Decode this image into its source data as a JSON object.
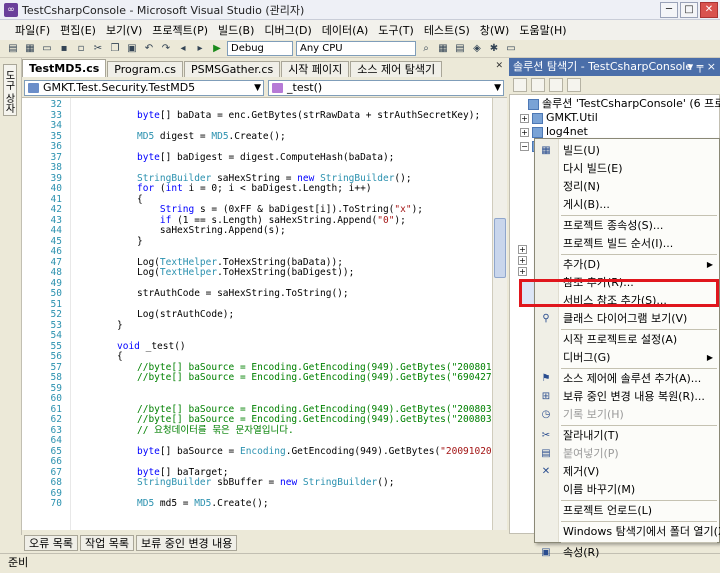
{
  "window": {
    "title": "TestCsharpConsole - Microsoft Visual Studio (관리자)",
    "minimize": "─",
    "maximize": "□",
    "close": "✕"
  },
  "menu": [
    "파일(F)",
    "편집(E)",
    "보기(V)",
    "프로젝트(P)",
    "빌드(B)",
    "디버그(D)",
    "데이터(A)",
    "도구(T)",
    "테스트(S)",
    "창(W)",
    "도움말(H)"
  ],
  "toolbar": {
    "config": "Debug",
    "platform": "Any CPU"
  },
  "toolbox_tab": "도구 상자",
  "doc_tabs": [
    "TestMD5.cs",
    "Program.cs",
    "PSMSGather.cs",
    "시작 페이지",
    "소스 제어 탐색기"
  ],
  "nav": {
    "type": "GMKT.Test.Security.TestMD5",
    "member": "_test()"
  },
  "code_lines": [
    {
      "n": "32",
      "t": ""
    },
    {
      "n": "33",
      "t": "<span class='kw'>byte</span>[] baData = enc.GetBytes(strRawData + strAuthSecretKey);"
    },
    {
      "n": "34",
      "t": ""
    },
    {
      "n": "35",
      "t": "<span class='cls'>MD5</span> digest = <span class='cls'>MD5</span>.Create();"
    },
    {
      "n": "36",
      "t": ""
    },
    {
      "n": "37",
      "t": "<span class='kw'>byte</span>[] baDigest = digest.ComputeHash(baData);"
    },
    {
      "n": "38",
      "t": ""
    },
    {
      "n": "39",
      "t": "<span class='cls'>StringBuilder</span> saHexString = <span class='kw'>new</span> <span class='cls'>StringBuilder</span>();"
    },
    {
      "n": "40",
      "t": "<span class='kw'>for</span> (<span class='kw'>int</span> i = 0; i &lt; baDigest.Length; i++)"
    },
    {
      "n": "41",
      "t": "{"
    },
    {
      "n": "42",
      "t": "    <span class='kw'>String</span> s = (0xFF &amp; baDigest[i]).ToString(<span class='str'>\"x\"</span>);"
    },
    {
      "n": "43",
      "t": "    <span class='kw'>if</span> (1 == s.Length) saHexString.Append(<span class='str'>\"0\"</span>);"
    },
    {
      "n": "44",
      "t": "    saHexString.Append(s);"
    },
    {
      "n": "45",
      "t": "}"
    },
    {
      "n": "46",
      "t": ""
    },
    {
      "n": "47",
      "t": "Log(<span class='cls'>TextHelper</span>.ToHexString(baData));"
    },
    {
      "n": "48",
      "t": "Log(<span class='cls'>TextHelper</span>.ToHexString(baDigest));"
    },
    {
      "n": "49",
      "t": ""
    },
    {
      "n": "50",
      "t": "strAuthCode = saHexString.ToString();"
    },
    {
      "n": "51",
      "t": ""
    },
    {
      "n": "52",
      "t": "Log(strAuthCode);"
    },
    {
      "n": "53",
      "t": "}",
      "indent": -1
    },
    {
      "n": "54",
      "t": ""
    },
    {
      "n": "55",
      "t": "<span class='kw'>void</span> _test()",
      "indent": -1
    },
    {
      "n": "56",
      "t": "{",
      "indent": -1
    },
    {
      "n": "57",
      "t": "<span class='cm'>//byte[] baSource = Encoding.GetEncoding(949).GetBytes(\"20080125133</span>"
    },
    {
      "n": "58",
      "t": "<span class='cm'>//byte[] baSource = Encoding.GetEncoding(949).GetBytes(\"6904271jeep</span>"
    },
    {
      "n": "59",
      "t": ""
    },
    {
      "n": "60",
      "t": ""
    },
    {
      "n": "61",
      "t": "<span class='cm'>//byte[] baSource = Encoding.GetEncoding(949).GetBytes(\"20080327115</span>"
    },
    {
      "n": "62",
      "t": "<span class='cm'>//byte[] baSource = Encoding.GetEncoding(949).GetBytes(\"20080327115</span>"
    },
    {
      "n": "63",
      "t": "<span class='cm'>// 요청데이터를 묶은 문자열입니다.</span>"
    },
    {
      "n": "64",
      "t": ""
    },
    {
      "n": "65",
      "t": "<span class='kw'>byte</span>[] baSource = <span class='cls'>Encoding</span>.GetEncoding(949).GetBytes(<span class='str'>\"200910201428</span>"
    },
    {
      "n": "66",
      "t": ""
    },
    {
      "n": "67",
      "t": "<span class='kw'>byte</span>[] baTarget;"
    },
    {
      "n": "68",
      "t": "<span class='cls'>StringBuilder</span> sbBuffer = <span class='kw'>new</span> <span class='cls'>StringBuilder</span>();"
    },
    {
      "n": "69",
      "t": ""
    },
    {
      "n": "70",
      "t": "<span class='cls'>MD5</span> md5 = <span class='cls'>MD5</span>.Create();"
    }
  ],
  "bottom_tabs": [
    "오류 목록",
    "작업 목록",
    "보류 중인 변경 내용"
  ],
  "status": "준비",
  "solution_explorer": {
    "title": "솔루션 탐색기 - TestCsharpConsole",
    "pin": "▾ ╤ ×",
    "tree": [
      {
        "label": "솔루션 'TestCsharpConsole' (6 프로젝트)",
        "level": 0,
        "pm": ""
      },
      {
        "label": "GMKT.Util",
        "level": 1,
        "pm": "+"
      },
      {
        "label": "log4net",
        "level": 1,
        "pm": "+"
      },
      {
        "label": "TestCsharpConsole",
        "level": 1,
        "pm": "−",
        "selected": true
      }
    ]
  },
  "context_menu": [
    {
      "label": "빌드(U)",
      "icon": "▦",
      "sep_after": false
    },
    {
      "label": "다시 빌드(E)",
      "icon": "",
      "sep_after": false
    },
    {
      "label": "정리(N)",
      "icon": "",
      "sep_after": false
    },
    {
      "label": "게시(B)...",
      "icon": "",
      "sep_after": true
    },
    {
      "label": "프로젝트 종속성(S)...",
      "icon": "",
      "sep_after": false
    },
    {
      "label": "프로젝트 빌드 순서(I)...",
      "icon": "",
      "sep_after": true
    },
    {
      "label": "추가(D)",
      "icon": "",
      "arrow": true,
      "sep_after": false
    },
    {
      "label": "참조 추가(R)...",
      "icon": "",
      "sep_after": false
    },
    {
      "label": "서비스 참조 추가(S)...",
      "icon": "",
      "highlight": true,
      "sep_after": false
    },
    {
      "label": "클래스 다이어그램 보기(V)",
      "icon": "⚲",
      "sep_after": true
    },
    {
      "label": "시작 프로젝트로 설정(A)",
      "icon": "",
      "sep_after": false
    },
    {
      "label": "디버그(G)",
      "icon": "",
      "arrow": true,
      "sep_after": true
    },
    {
      "label": "소스 제어에 솔루션 추가(A)...",
      "icon": "⚑",
      "sep_after": false
    },
    {
      "label": "보류 중인 변경 내용 복원(R)...",
      "icon": "⊞",
      "sep_after": false
    },
    {
      "label": "기록 보기(H)",
      "icon": "◷",
      "disabled": true,
      "sep_after": true
    },
    {
      "label": "잘라내기(T)",
      "icon": "✂",
      "sep_after": false
    },
    {
      "label": "붙여넣기(P)",
      "icon": "▤",
      "disabled": true,
      "sep_after": false
    },
    {
      "label": "제거(V)",
      "icon": "✕",
      "sep_after": false
    },
    {
      "label": "이름 바꾸기(M)",
      "icon": "",
      "sep_after": true
    },
    {
      "label": "프로젝트 언로드(L)",
      "icon": "",
      "sep_after": true
    },
    {
      "label": "Windows 탐색기에서 폴더 열기(X)",
      "icon": "",
      "sep_after": true
    },
    {
      "label": "속성(R)",
      "icon": "▣",
      "sep_after": false
    }
  ]
}
